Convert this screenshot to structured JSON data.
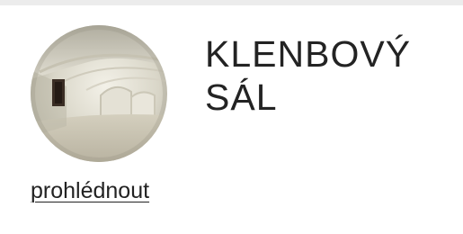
{
  "room_card": {
    "title": "KLENBOVÝ SÁL",
    "link_label": "prohlédnout",
    "thumbnail_icon": "vaulted-hall-photo",
    "accent_color": "#222222"
  }
}
